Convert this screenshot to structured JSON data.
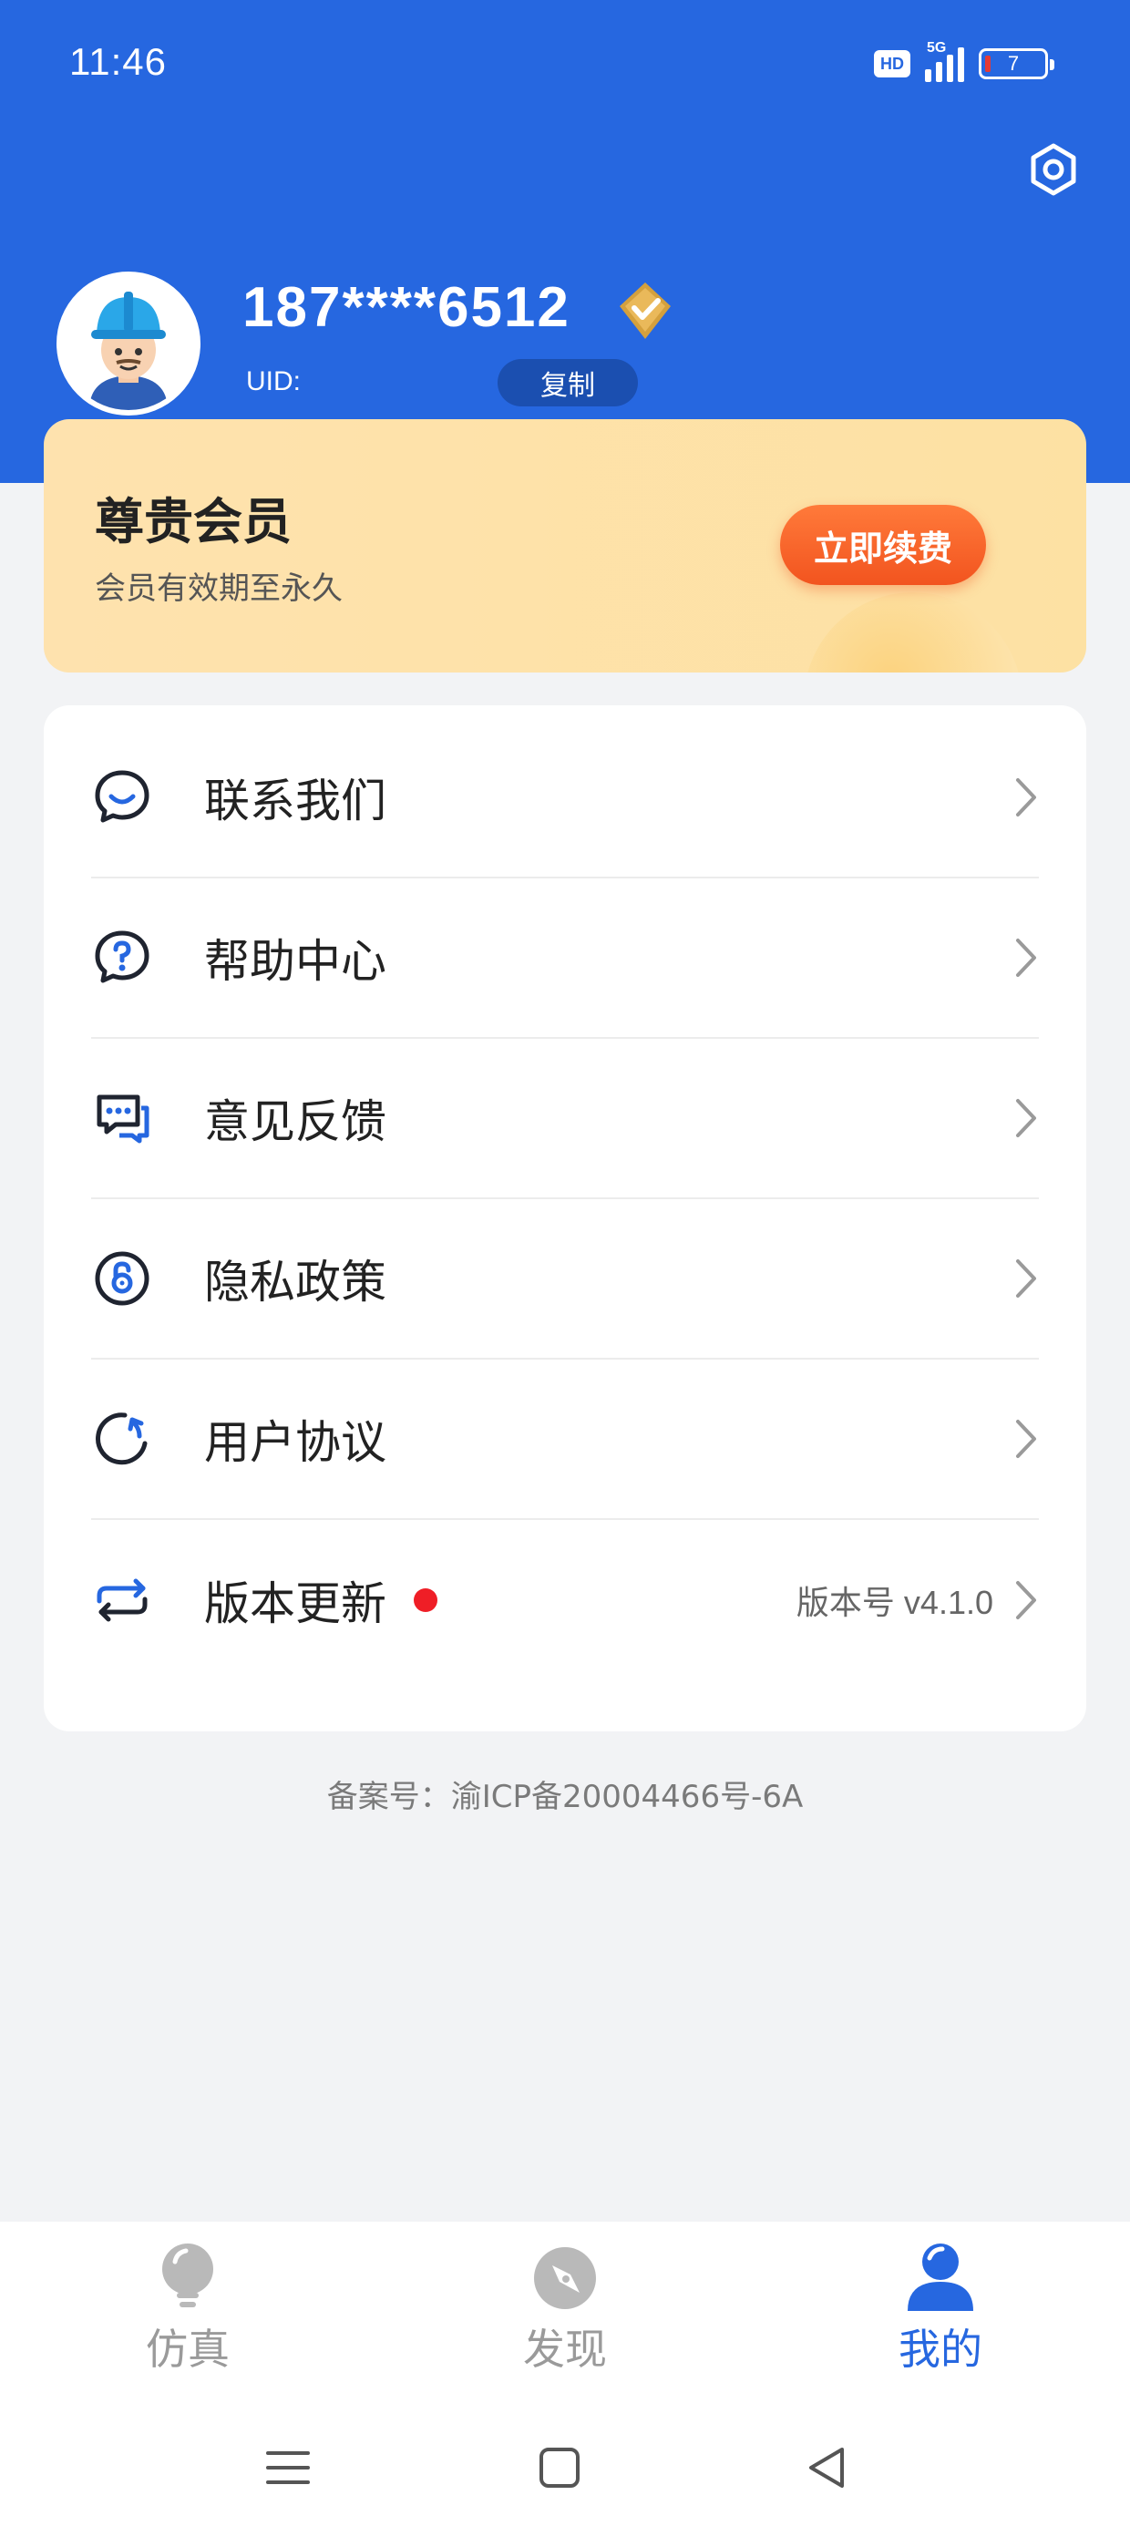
{
  "status_bar": {
    "time": "11:46",
    "network_badge": "HD",
    "network_type": "5G",
    "battery_level": "7"
  },
  "profile": {
    "phone_masked": "187****6512",
    "uid_label": "UID:",
    "copy_label": "复制"
  },
  "vip": {
    "title": "尊贵会员",
    "subtitle": "会员有效期至永久",
    "renew_label": "立即续费"
  },
  "menu": {
    "items": [
      {
        "label": "联系我们",
        "icon": "chat-smile-icon"
      },
      {
        "label": "帮助中心",
        "icon": "help-question-icon"
      },
      {
        "label": "意见反馈",
        "icon": "feedback-message-icon"
      },
      {
        "label": "隐私政策",
        "icon": "privacy-lock-icon"
      },
      {
        "label": "用户协议",
        "icon": "agreement-refresh-icon"
      },
      {
        "label": "版本更新",
        "icon": "update-sync-icon",
        "value": "版本号 v4.1.0",
        "has_new": true
      }
    ]
  },
  "footer": {
    "icp": "备案号：渝ICP备20004466号-6A"
  },
  "tabbar": {
    "tabs": [
      {
        "label": "仿真",
        "icon": "lightbulb-icon",
        "active": false
      },
      {
        "label": "发现",
        "icon": "compass-icon",
        "active": false
      },
      {
        "label": "我的",
        "icon": "person-icon",
        "active": true
      }
    ]
  },
  "colors": {
    "primary": "#2667e0",
    "accent": "#f2541f",
    "vip_bg": "#fee2ae",
    "dot": "#ef1e26"
  }
}
